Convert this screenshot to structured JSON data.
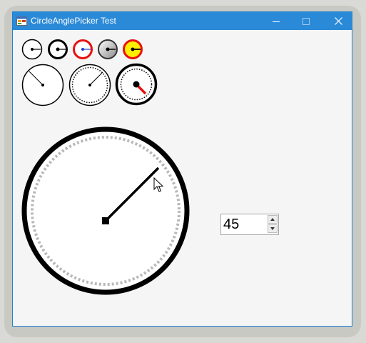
{
  "window": {
    "title": "CircleAnglePicker Test",
    "minimize_icon": "minimize-icon",
    "maximize_icon": "maximize-icon",
    "close_icon": "close-icon"
  },
  "pickers_small": [
    {
      "angle": 0,
      "border": "#000000",
      "fill": "#ffffff",
      "needle": "#000000"
    },
    {
      "angle": 0,
      "border": "#000000",
      "fill": "#ffffff",
      "needle": "#000000"
    },
    {
      "angle": 0,
      "border": "#e81010",
      "fill": "#ffffff",
      "needle": "#1a3fd0"
    },
    {
      "angle": 0,
      "border": "#333333",
      "fill": "gradient",
      "needle": "#000000"
    },
    {
      "angle": 0,
      "border": "#e81010",
      "fill": "#ffee00",
      "needle": "#000000"
    }
  ],
  "pickers_medium": [
    {
      "angle": 135,
      "style": "plain"
    },
    {
      "angle": 45,
      "style": "dotted"
    },
    {
      "angle": 315,
      "style": "dotted-red-needle"
    }
  ],
  "main_picker": {
    "angle": 45
  },
  "numeric": {
    "value": "45",
    "up_icon": "spin-up-icon",
    "down_icon": "spin-down-icon"
  }
}
